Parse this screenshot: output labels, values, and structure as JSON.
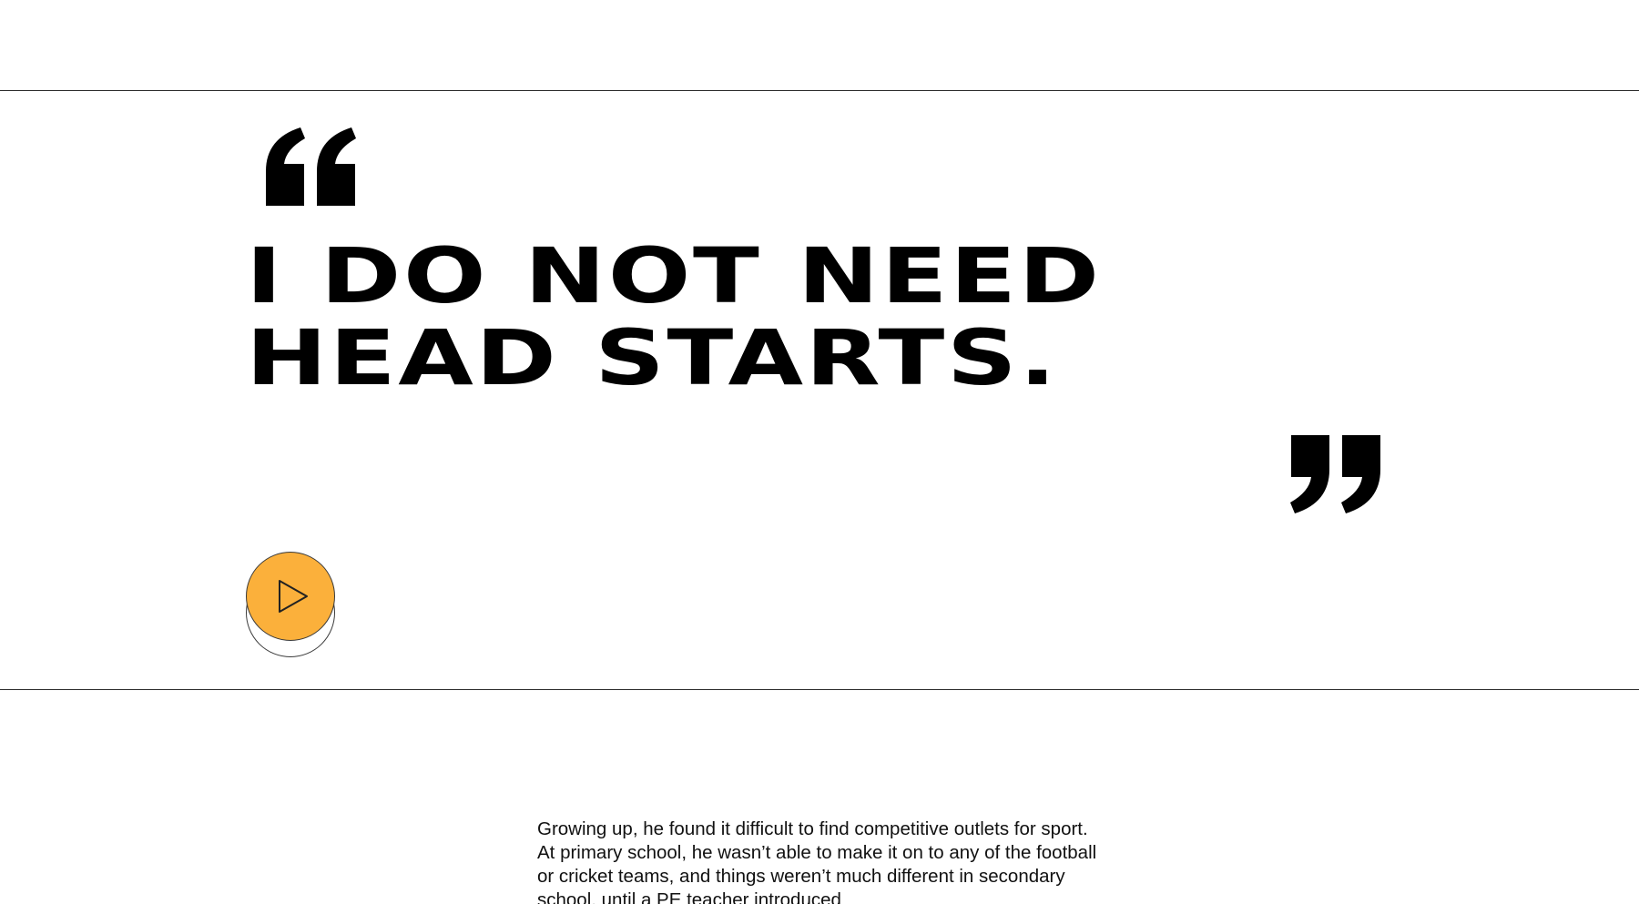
{
  "colors": {
    "play_button": "#FBB03B",
    "text": "#000000",
    "rule": "#2a2a2a"
  },
  "quote": {
    "open_icon": "open-quote-icon",
    "close_icon": "close-quote-icon",
    "lines": [
      "I DO NOT NEED",
      "HEAD STARTS."
    ]
  },
  "video": {
    "icon": "play-icon"
  },
  "article": {
    "paragraph": "Growing up, he found it difficult to find competitive outlets for sport. At primary school, he wasn’t able to make it on to any of the football or cricket teams, and things weren’t much different in secondary school, until a PE teacher introduced"
  }
}
